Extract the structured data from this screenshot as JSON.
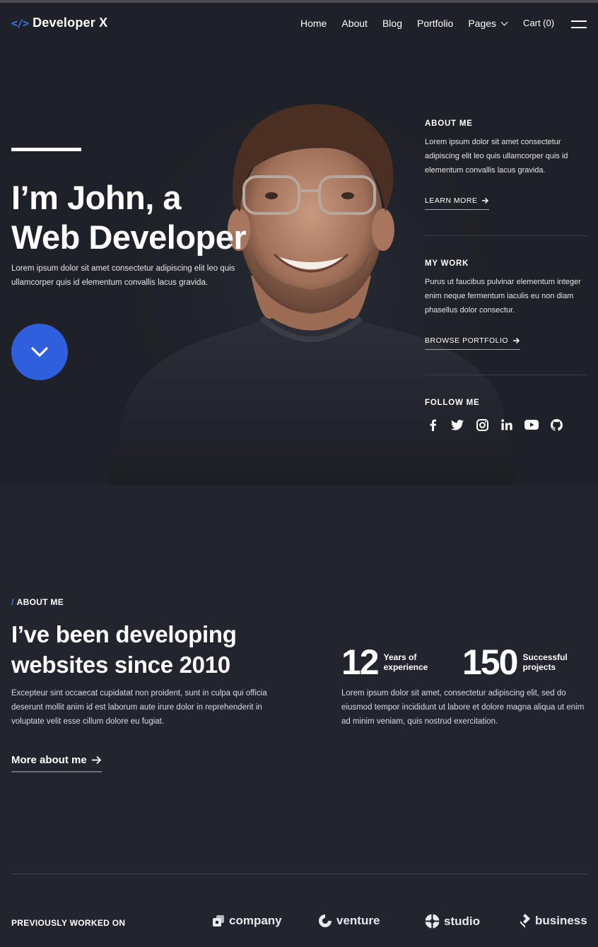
{
  "nav": {
    "logo_icon": "</>",
    "logo_text": "Developer X",
    "items": [
      {
        "label": "Home"
      },
      {
        "label": "About"
      },
      {
        "label": "Blog"
      },
      {
        "label": "Portfolio"
      },
      {
        "label": "Pages"
      }
    ],
    "cart": "Cart (0)"
  },
  "hero": {
    "title_line1": "I’m John, a",
    "title_line2": "Web Developer",
    "text": "Lorem ipsum dolor sit amet consectetur adipiscing elit leo quis ullamcorper quis id elementum convallis lacus gravida."
  },
  "side": {
    "about": {
      "heading": "ABOUT ME",
      "text": "Lorem ipsum dolor sit amet consectetur adipiscing elit leo quis ullamcorper quis id elementum convallis lacus gravida.",
      "link": "LEARN MORE"
    },
    "work": {
      "heading": "MY WORK",
      "text": "Purus ut faucibus pulvinar elementum integer enim neque fermentum iaculis eu non diam phasellus dolor consectur.",
      "link": "BROWSE PORTFOLIO"
    },
    "follow": {
      "heading": "FOLLOW ME",
      "icons": [
        "facebook-icon",
        "twitter-icon",
        "instagram-icon",
        "linkedin-icon",
        "youtube-icon",
        "github-icon"
      ]
    }
  },
  "about": {
    "kicker_slash": "/",
    "kicker": "ABOUT ME",
    "title_line1": "I’ve been developing",
    "title_line2": "websites since 2010",
    "text": "Excepteur sint occaecat cupidatat non proident, sunt in culpa qui officia deserunt mollit anim id est laborum aute irure dolor in reprehenderit in voluptate velit esse cillum dolore eu fugiat.",
    "link": "More about me",
    "stats": [
      {
        "number": "12",
        "label_line1": "Years of",
        "label_line2": "experience"
      },
      {
        "number": "150",
        "label_line1": "Successful",
        "label_line2": "projects"
      }
    ],
    "stats_text": "Lorem ipsum dolor sit amet, consectetur adipiscing elit, sed do eiusmod tempor incididunt ut labore et dolore magna aliqua ut enim ad minim veniam, quis nostrud exercitation."
  },
  "clients": {
    "heading": "PREVIOUSLY WORKED ON",
    "brands": [
      {
        "name": "company"
      },
      {
        "name": "venture"
      },
      {
        "name": "studio"
      },
      {
        "name": "business"
      }
    ]
  },
  "colors": {
    "accent": "#3f73f0",
    "button": "#2f5fdc",
    "background": "#22252e"
  }
}
